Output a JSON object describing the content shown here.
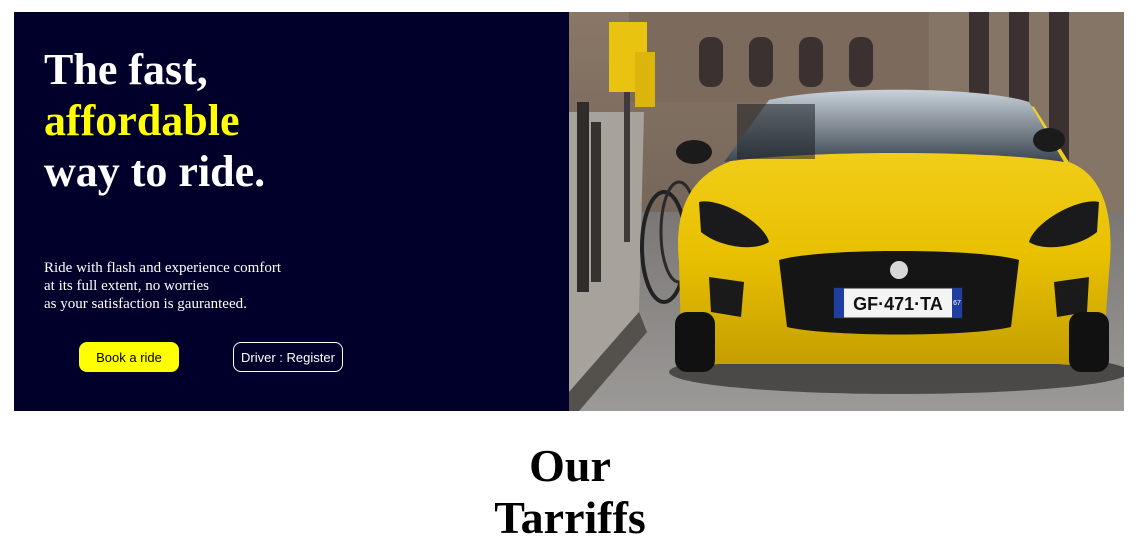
{
  "hero": {
    "headline": [
      "The fast,",
      "affordable",
      "way to ride."
    ],
    "description": [
      "Ride with flash and experience comfort",
      "at its full extent, no worries",
      "as your satisfaction is gauranteed."
    ],
    "buttons": {
      "book": "Book a ride",
      "driver": "Driver : Register"
    },
    "image": {
      "subject": "yellow sports car parked on city street",
      "plate": "GF·471·TA",
      "plate_side": "67"
    }
  },
  "section": {
    "title": [
      "Our",
      "Tarriffs"
    ]
  },
  "colors": {
    "hero_bg": "#00002a",
    "accent": "#ffff00",
    "text_light": "#ffffff",
    "text_dark": "#000000"
  }
}
